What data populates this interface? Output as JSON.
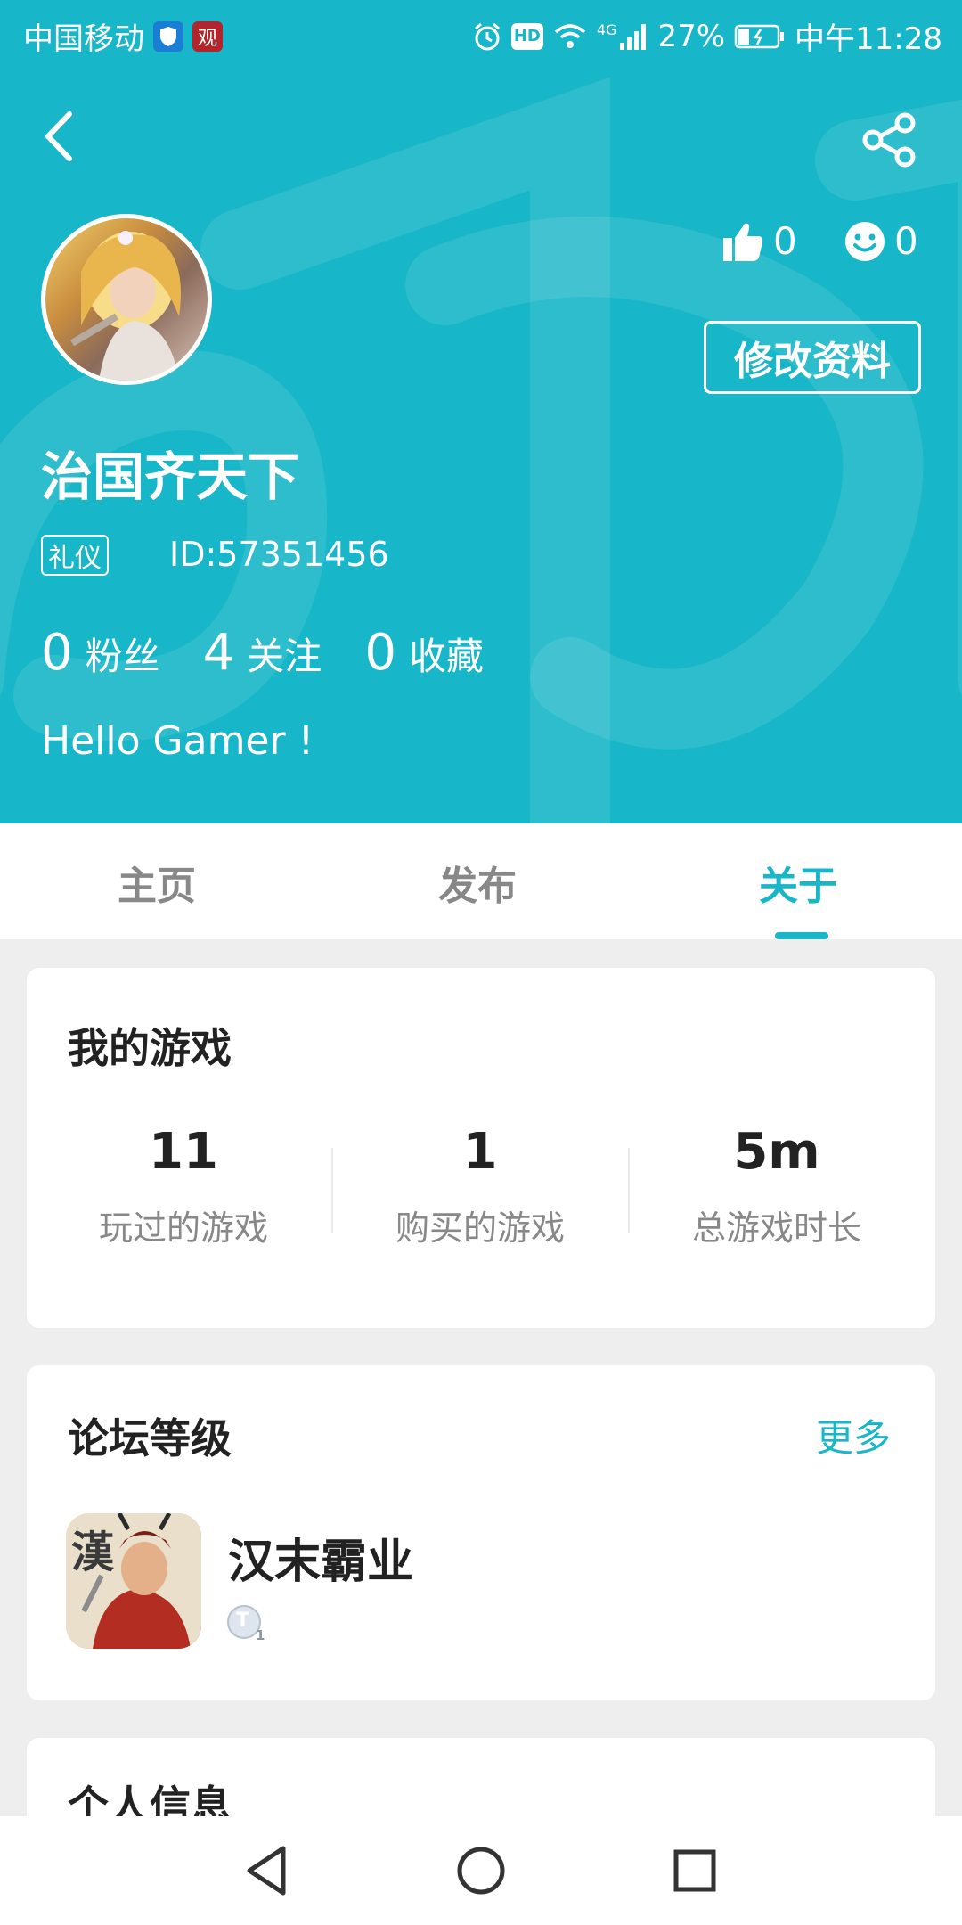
{
  "status_bar": {
    "carrier": "中国移动",
    "shield_badge": "",
    "app_badge": "观",
    "network_badge": "HD",
    "signal_label": "4G",
    "battery": "27%",
    "time": "中午11:28"
  },
  "profile": {
    "likes": "0",
    "smiles": "0",
    "edit_label": "修改资料",
    "username": "治国齐天下",
    "tag": "礼仪",
    "id": "ID:57351456",
    "followers_count": "0",
    "followers_label": "粉丝",
    "following_count": "4",
    "following_label": "关注",
    "favorites_count": "0",
    "favorites_label": "收藏",
    "bio": "Hello Gamer !"
  },
  "tabs": [
    {
      "label": "主页"
    },
    {
      "label": "发布"
    },
    {
      "label": "关于"
    }
  ],
  "my_games": {
    "title": "我的游戏",
    "stats": [
      {
        "value": "11",
        "label": "玩过的游戏"
      },
      {
        "value": "1",
        "label": "购买的游戏"
      },
      {
        "value": "5m",
        "label": "总游戏时长"
      }
    ]
  },
  "forum_level": {
    "title": "论坛等级",
    "more": "更多",
    "game_icon_char": "漢",
    "game_name": "汉末霸业",
    "level_char": "T",
    "level_num": "1"
  },
  "personal_info": {
    "title": "个人信息"
  },
  "colors": {
    "accent": "#17b6c8",
    "header_bg": "#17b6c8",
    "page_bg": "#eeeeee"
  }
}
